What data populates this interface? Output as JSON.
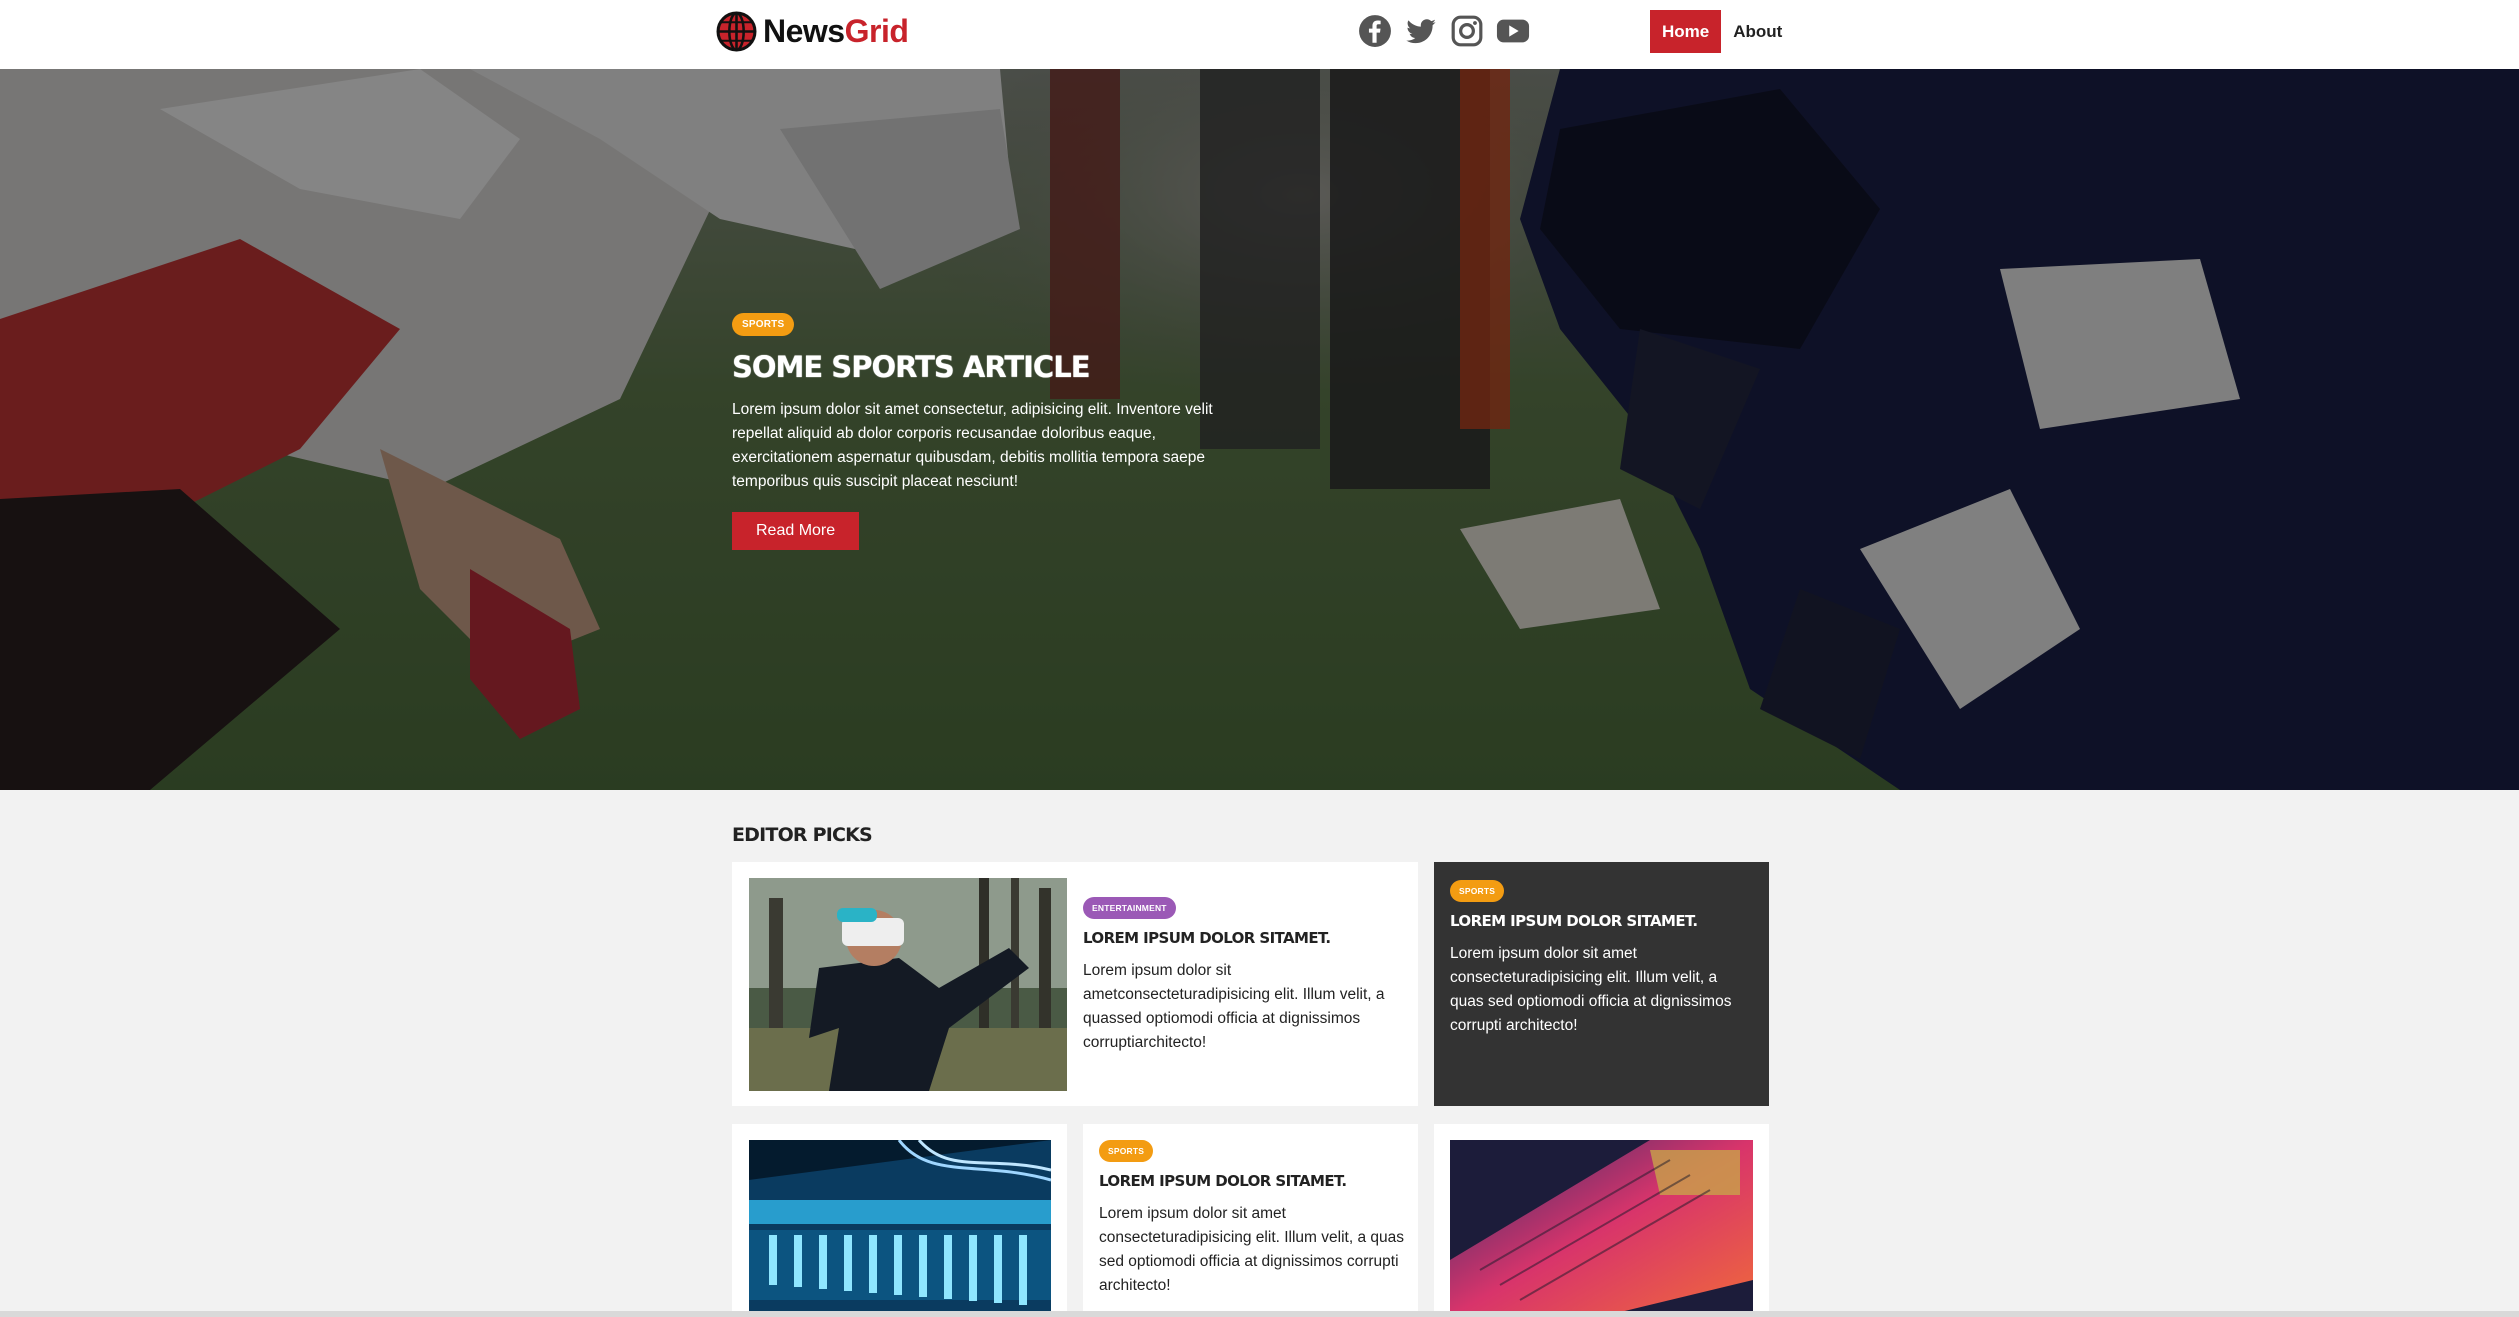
{
  "brand": {
    "part1": "News",
    "part2": "Grid"
  },
  "socials": [
    "facebook-icon",
    "twitter-icon",
    "instagram-icon",
    "youtube-icon"
  ],
  "nav": {
    "home": "Home",
    "about": "About"
  },
  "colors": {
    "accent": "#c8232b",
    "sports": "#f39c12",
    "entertainment": "#9b59b6",
    "dark_card": "#333333"
  },
  "hero": {
    "badge": "SPORTS",
    "title": "SOME SPORTS ARTICLE",
    "text": "Lorem ipsum dolor sit amet consectetur, adipisicing elit. Inventore velit repellat aliquid ab dolor corporis recusandae doloribus eaque, exercitationem aspernatur quibusdam, debitis mollitia tempora saepe temporibus quis suscipit placeat nesciunt!",
    "button": "Read More"
  },
  "editor_picks": {
    "title": "EDITOR PICKS",
    "cards": [
      {
        "badge": "ENTERTAINMENT",
        "title": "LOREM IPSUM DOLOR SITAMET.",
        "text": "Lorem ipsum dolor sit ametconsecteturadipisicing elit. Illum velit, a quassed optiomodi officia at dignissimos corruptiarchitecto!"
      },
      {
        "badge": "SPORTS",
        "title": "LOREM IPSUM DOLOR SITAMET.",
        "text": "Lorem ipsum dolor sit amet consecteturadipisicing elit. Illum velit, a quas sed optiomodi officia at dignissimos corrupti architecto!"
      },
      {
        "badge": "SPORTS",
        "title": "LOREM IPSUM DOLOR SITAMET.",
        "text": "Lorem ipsum dolor sit amet consecteturadipisicing elit. Illum velit, a quas sed optiomodi officia at dignissimos corrupti architecto!"
      }
    ]
  }
}
